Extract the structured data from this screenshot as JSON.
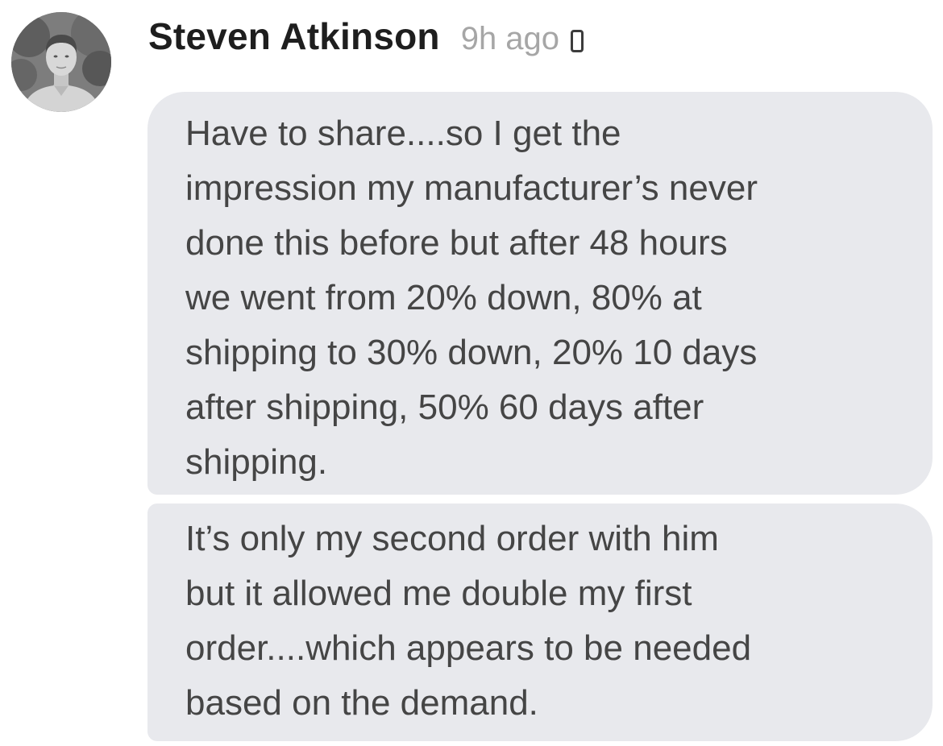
{
  "message": {
    "author": "Steven Atkinson",
    "timestamp": "9h ago",
    "status_icon": "mobile-device-icon",
    "bubbles": [
      {
        "lines": [
          "Have to share....so I get the",
          "impression my manufacturer’s never",
          "done this before but after 48 hours",
          "we went from 20% down, 80% at",
          "shipping to 30% down, 20% 10 days",
          "after shipping, 50% 60 days after",
          "shipping."
        ]
      },
      {
        "lines": [
          "It’s only my second order with him",
          "but it allowed me double my first",
          "order....which appears to be needed",
          "based on the demand."
        ]
      }
    ]
  },
  "colors": {
    "bubble_background": "#e8e9ed",
    "author_text": "#1e1e1e",
    "timestamp_text": "#a6a6a6",
    "message_text": "#454545"
  }
}
